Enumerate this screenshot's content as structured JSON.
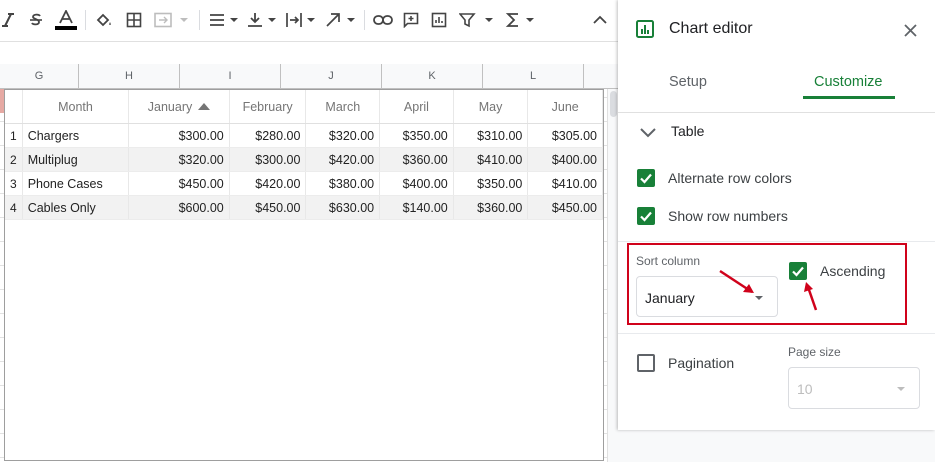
{
  "toolbar": {
    "icons": [
      "italic-icon",
      "strikethrough-icon",
      "text-color-icon",
      "fill-color-icon",
      "borders-icon",
      "merge-cells-icon",
      "horizontal-align-icon",
      "vertical-align-icon",
      "text-wrap-icon",
      "text-rotation-icon",
      "insert-link-icon",
      "insert-comment-icon",
      "insert-chart-icon",
      "filter-icon",
      "functions-icon",
      "collapse-toolbar-icon"
    ],
    "text_color": "#000000"
  },
  "columns": [
    "G",
    "H",
    "I",
    "J",
    "K",
    "L"
  ],
  "chart_table": {
    "headers": [
      "Month",
      "January",
      "February",
      "March",
      "April",
      "May",
      "June"
    ],
    "sorted_column": "January",
    "rows": [
      {
        "n": "1",
        "cells": [
          "Chargers",
          "$300.00",
          "$280.00",
          "$320.00",
          "$350.00",
          "$310.00",
          "$305.00"
        ]
      },
      {
        "n": "2",
        "cells": [
          "Multiplug",
          "$320.00",
          "$300.00",
          "$420.00",
          "$360.00",
          "$410.00",
          "$400.00"
        ]
      },
      {
        "n": "3",
        "cells": [
          "Phone Cases",
          "$450.00",
          "$420.00",
          "$380.00",
          "$400.00",
          "$350.00",
          "$410.00"
        ]
      },
      {
        "n": "4",
        "cells": [
          "Cables Only",
          "$600.00",
          "$450.00",
          "$630.00",
          "$140.00",
          "$360.00",
          "$450.00"
        ]
      }
    ]
  },
  "editor": {
    "title": "Chart editor",
    "tabs": {
      "setup": "Setup",
      "customize": "Customize",
      "active": "Customize"
    },
    "section": "Table",
    "alt_row_colors": {
      "label": "Alternate row colors",
      "checked": true
    },
    "show_row_numbers": {
      "label": "Show row numbers",
      "checked": true
    },
    "sort_column": {
      "label": "Sort column",
      "value": "January"
    },
    "ascending": {
      "label": "Ascending",
      "checked": true
    },
    "pagination": {
      "label": "Pagination",
      "checked": false
    },
    "page_size": {
      "label": "Page size",
      "value": "10"
    },
    "accent": "#188038",
    "highlight": "#d0021b"
  }
}
